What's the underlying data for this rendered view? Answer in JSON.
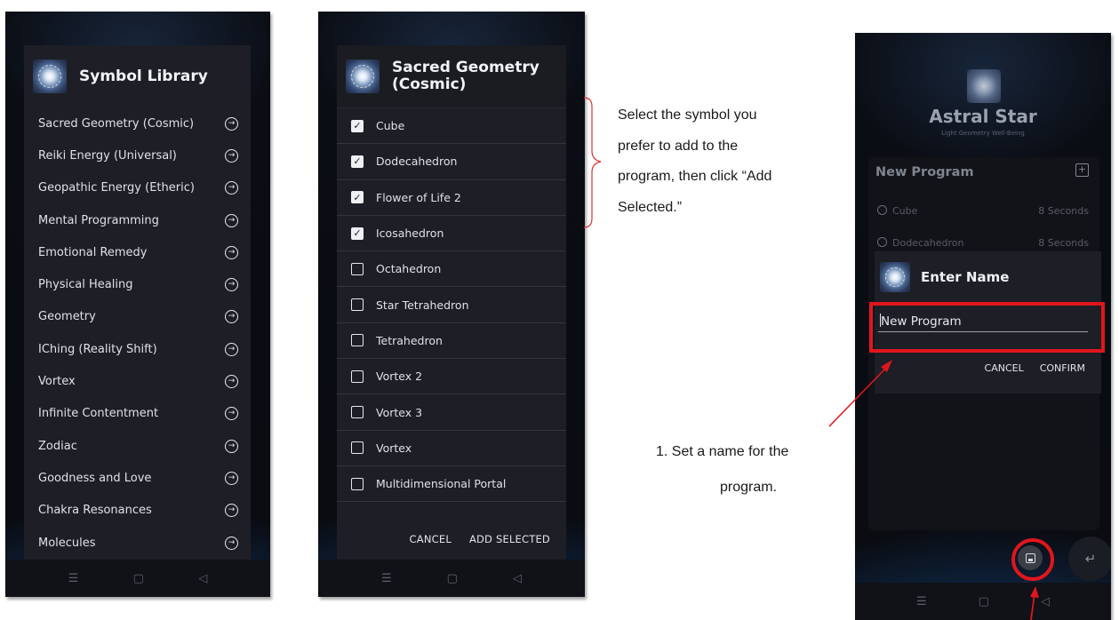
{
  "symbol_library": {
    "title": "Symbol Library",
    "items": [
      {
        "label": "Sacred Geometry (Cosmic)",
        "icon": "arrow-circle-right-icon"
      },
      {
        "label": "Reiki Energy (Universal)",
        "icon": "arrow-circle-right-icon"
      },
      {
        "label": "Geopathic Energy (Etheric)",
        "icon": "arrow-circle-right-icon"
      },
      {
        "label": "Mental Programming",
        "icon": "arrow-circle-right-icon"
      },
      {
        "label": "Emotional Remedy",
        "icon": "arrow-circle-right-icon"
      },
      {
        "label": "Physical Healing",
        "icon": "arrow-circle-right-icon"
      },
      {
        "label": "Geometry",
        "icon": "arrow-circle-right-icon"
      },
      {
        "label": "IChing (Reality Shift)",
        "icon": "arrow-circle-right-icon"
      },
      {
        "label": "Vortex",
        "icon": "arrow-circle-right-icon"
      },
      {
        "label": "Infinite Contentment",
        "icon": "arrow-circle-right-icon"
      },
      {
        "label": "Zodiac",
        "icon": "arrow-circle-right-icon"
      },
      {
        "label": "Goodness and Love",
        "icon": "arrow-circle-right-icon"
      },
      {
        "label": "Chakra Resonances",
        "icon": "arrow-circle-right-icon"
      },
      {
        "label": "Molecules",
        "icon": "arrow-circle-right-icon"
      }
    ]
  },
  "sacred_geometry": {
    "title_line1": "Sacred Geometry",
    "title_line2": "(Cosmic)",
    "items": [
      {
        "label": "Cube",
        "checked": true
      },
      {
        "label": "Dodecahedron",
        "checked": true
      },
      {
        "label": "Flower of Life 2",
        "checked": true
      },
      {
        "label": "Icosahedron",
        "checked": true
      },
      {
        "label": "Octahedron",
        "checked": false
      },
      {
        "label": "Star Tetrahedron",
        "checked": false
      },
      {
        "label": "Tetrahedron",
        "checked": false
      },
      {
        "label": "Vortex 2",
        "checked": false
      },
      {
        "label": "Vortex 3",
        "checked": false
      },
      {
        "label": "Vortex",
        "checked": false
      },
      {
        "label": "Multidimensional Portal",
        "checked": false
      }
    ],
    "cancel_label": "CANCEL",
    "add_label": "ADD SELECTED"
  },
  "astral": {
    "app_title": "Astral Star",
    "app_subtitle": "Light Geometry Well-Being",
    "program_title": "New Program",
    "program_rows": [
      {
        "label": "Cube",
        "duration": "8 Seconds"
      },
      {
        "label": "Dodecahedron",
        "duration": "8 Seconds"
      }
    ],
    "enter_name_title": "Enter Name",
    "name_value": "New Program",
    "cancel_label": "CANCEL",
    "confirm_label": "CONFIRM",
    "enter_icon_glyph": "↵",
    "add_icon_glyph": "+"
  },
  "nav": {
    "menu": "☰",
    "home": "▢",
    "back": "◁"
  },
  "annotations": {
    "select_note_lines": [
      "Select the symbol you",
      "prefer to add to the",
      "program, then click “Add",
      "Selected.”"
    ],
    "name_note_lines": [
      "1. Set a name for the",
      "program."
    ]
  },
  "colors": {
    "highlight": "#e0161c",
    "dialog_bg": "#1e1f26"
  }
}
